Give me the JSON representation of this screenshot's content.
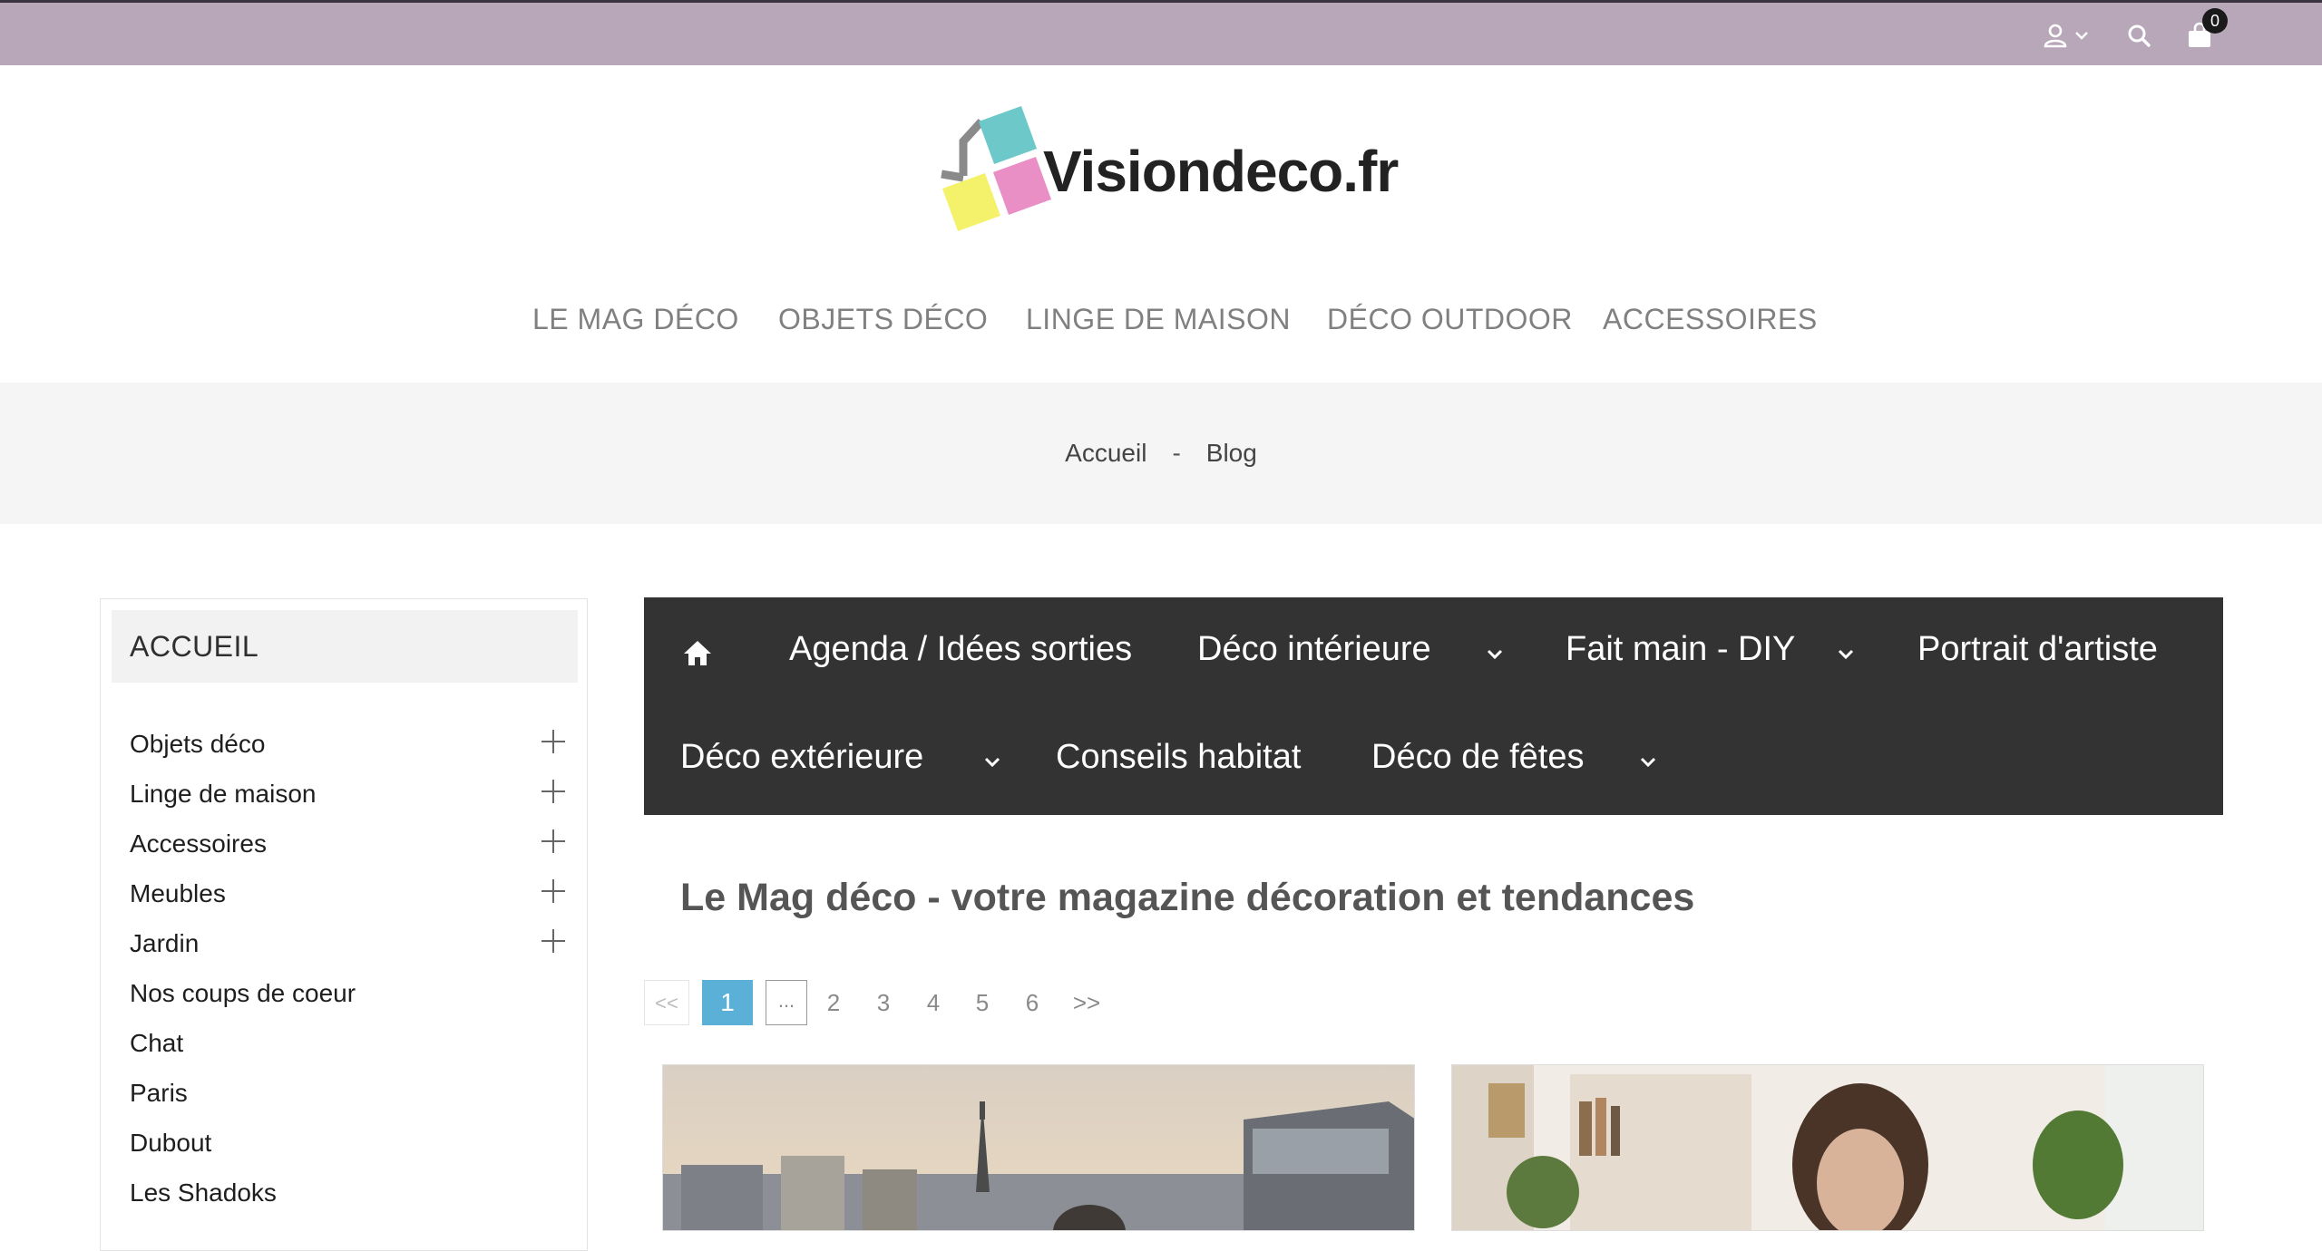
{
  "topbar": {
    "cart_count": "0",
    "icons": [
      "user-icon",
      "chevron-down-icon",
      "search-icon",
      "shopping-bag-icon"
    ]
  },
  "logo": {
    "text": "Visiondeco.fr"
  },
  "main_nav": [
    "LE MAG DÉCO",
    "OBJETS DÉCO",
    "LINGE DE MAISON",
    "DÉCO OUTDOOR",
    "ACCESSOIRES"
  ],
  "breadcrumb": {
    "home": "Accueil",
    "sep": "-",
    "current": "Blog"
  },
  "sidebar": {
    "heading": "ACCUEIL",
    "items": [
      {
        "label": "Objets déco",
        "expandable": true
      },
      {
        "label": "Linge de maison",
        "expandable": true
      },
      {
        "label": "Accessoires",
        "expandable": true
      },
      {
        "label": "Meubles",
        "expandable": true
      },
      {
        "label": "Jardin",
        "expandable": true
      },
      {
        "label": "Nos coups de coeur",
        "expandable": false
      },
      {
        "label": "Chat",
        "expandable": false
      },
      {
        "label": "Paris",
        "expandable": false
      },
      {
        "label": "Dubout",
        "expandable": false
      },
      {
        "label": "Les Shadoks",
        "expandable": false
      }
    ]
  },
  "blog_nav": {
    "items": [
      {
        "label": "Agenda / Idées sorties",
        "dropdown": false
      },
      {
        "label": "Déco intérieure",
        "dropdown": true
      },
      {
        "label": "Fait main - DIY",
        "dropdown": true
      },
      {
        "label": "Portrait d'artiste",
        "dropdown": false
      },
      {
        "label": "Déco extérieure",
        "dropdown": true
      },
      {
        "label": "Conseils habitat",
        "dropdown": false
      },
      {
        "label": "Déco de fêtes",
        "dropdown": true
      }
    ]
  },
  "page_title": "Le Mag déco - votre magazine décoration et tendances",
  "pagination": {
    "prev": "<<",
    "current": "1",
    "ellipsis": "...",
    "pages": [
      "2",
      "3",
      "4",
      "5",
      "6"
    ],
    "next": ">>"
  },
  "colors": {
    "topbar": "#b8a6b9",
    "blog_nav_bg": "#333333",
    "active_page": "#5ab0d6",
    "logo_teal": "#6cc8c9",
    "logo_pink": "#e98fc6",
    "logo_yellow": "#f4f26a"
  }
}
